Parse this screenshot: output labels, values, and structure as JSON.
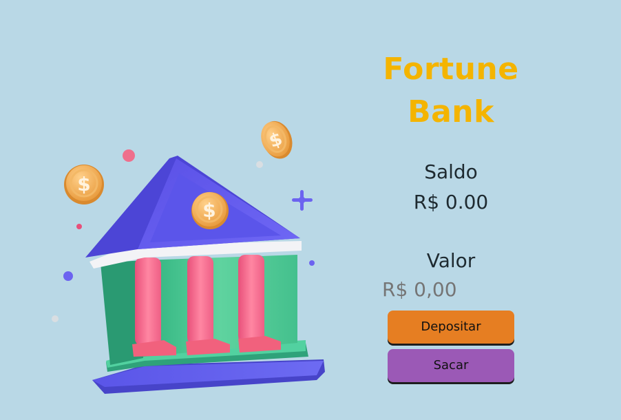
{
  "app": {
    "title_line1": "Fortune",
    "title_line2": "Bank"
  },
  "balance": {
    "label": "Saldo",
    "amount": "R$ 0.00"
  },
  "amount_input": {
    "label": "Valor",
    "placeholder": "R$ 0,00"
  },
  "actions": {
    "deposit_label": "Depositar",
    "withdraw_label": "Sacar"
  },
  "colors": {
    "background": "#b9d8e6",
    "title": "#f4b400",
    "deposit_button": "#e67e22",
    "withdraw_button": "#9b59b6"
  },
  "illustration": {
    "icon": "bank-building-icon"
  }
}
